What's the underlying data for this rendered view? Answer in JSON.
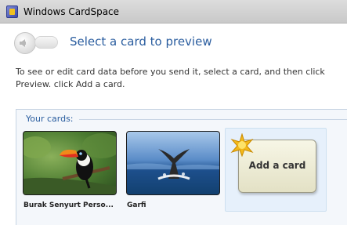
{
  "window": {
    "title": "Windows CardSpace"
  },
  "header": {
    "heading": "Select a card to preview"
  },
  "instructions": "To see or edit card data before you send it, select a card, and then click Preview. click Add a card.",
  "cards_panel": {
    "heading": "Your cards:",
    "cards": [
      {
        "label": "Burak  Senyurt Perso..."
      },
      {
        "label": "Garfi"
      }
    ],
    "add_card_label": "Add a card"
  },
  "icons": {
    "app": "cardspace-icon",
    "back": "back-arrow-icon",
    "add": "star-icon"
  },
  "colors": {
    "heading_blue": "#2a5d9f",
    "panel_border": "#c7d4e3"
  }
}
